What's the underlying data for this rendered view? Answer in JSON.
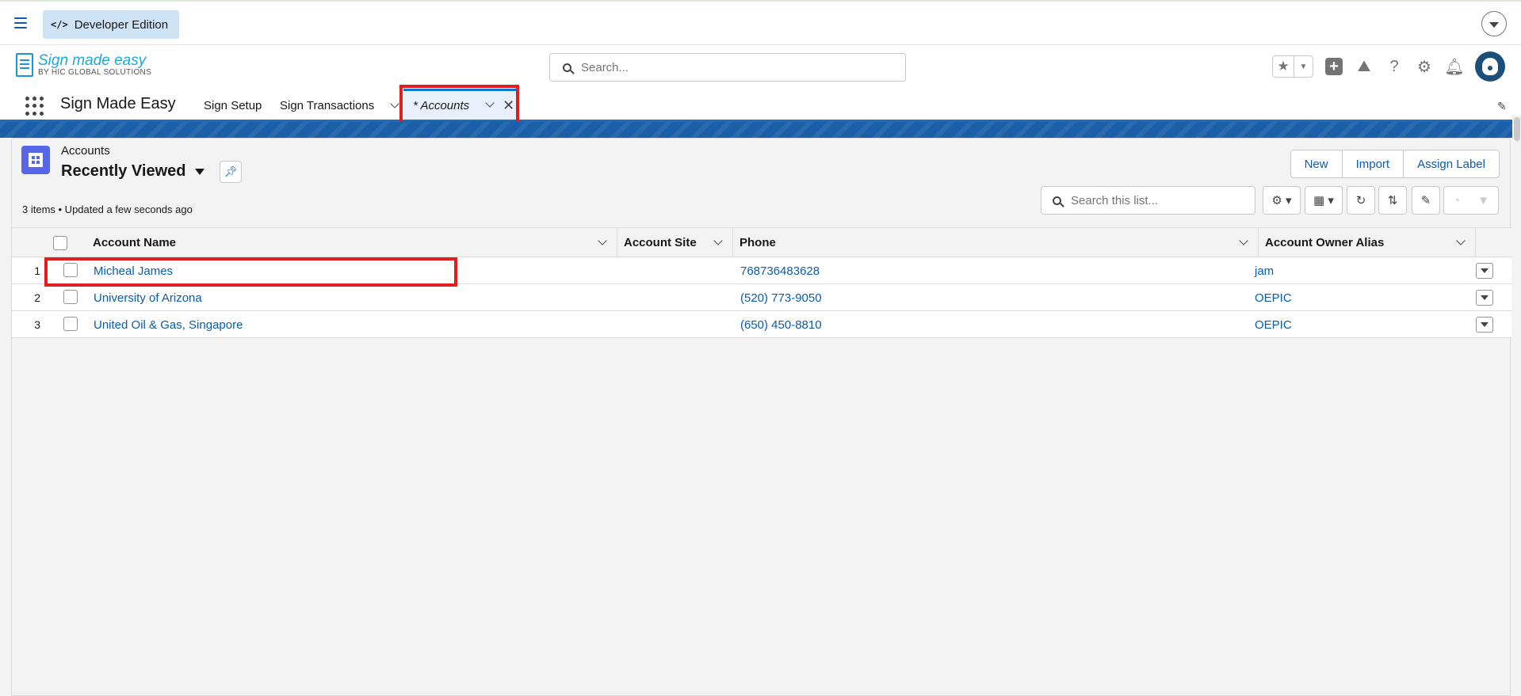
{
  "devbar": {
    "label": "Developer Edition",
    "code_glyph": "</>"
  },
  "logo": {
    "line1": "Sign made easy",
    "line2": "BY HIC GLOBAL SOLUTIONS"
  },
  "header": {
    "search_placeholder": "Search..."
  },
  "nav": {
    "app_name": "Sign Made Easy",
    "items": [
      {
        "label": "Sign Setup"
      },
      {
        "label": "Sign Transactions"
      }
    ],
    "active_tab": "* Accounts"
  },
  "list": {
    "object_label": "Accounts",
    "view_name": "Recently Viewed",
    "meta": "3 items • Updated a few seconds ago",
    "actions": {
      "new": "New",
      "import": "Import",
      "assign_label": "Assign Label"
    },
    "search_placeholder": "Search this list...",
    "columns": [
      "Account Name",
      "Account Site",
      "Phone",
      "Account Owner Alias"
    ],
    "rows": [
      {
        "num": "1",
        "name": "Micheal James",
        "site": "",
        "phone": "768736483628",
        "owner": "jam"
      },
      {
        "num": "2",
        "name": "University of Arizona",
        "site": "",
        "phone": "(520) 773-9050",
        "owner": "OEPIC"
      },
      {
        "num": "3",
        "name": "United Oil & Gas, Singapore",
        "site": "",
        "phone": "(650) 450-8810",
        "owner": "OEPIC"
      }
    ]
  },
  "colors": {
    "link": "#0b5cab",
    "brand": "#1b6fba",
    "highlight": "#e01e1e",
    "object_icon": "#5867e8"
  }
}
